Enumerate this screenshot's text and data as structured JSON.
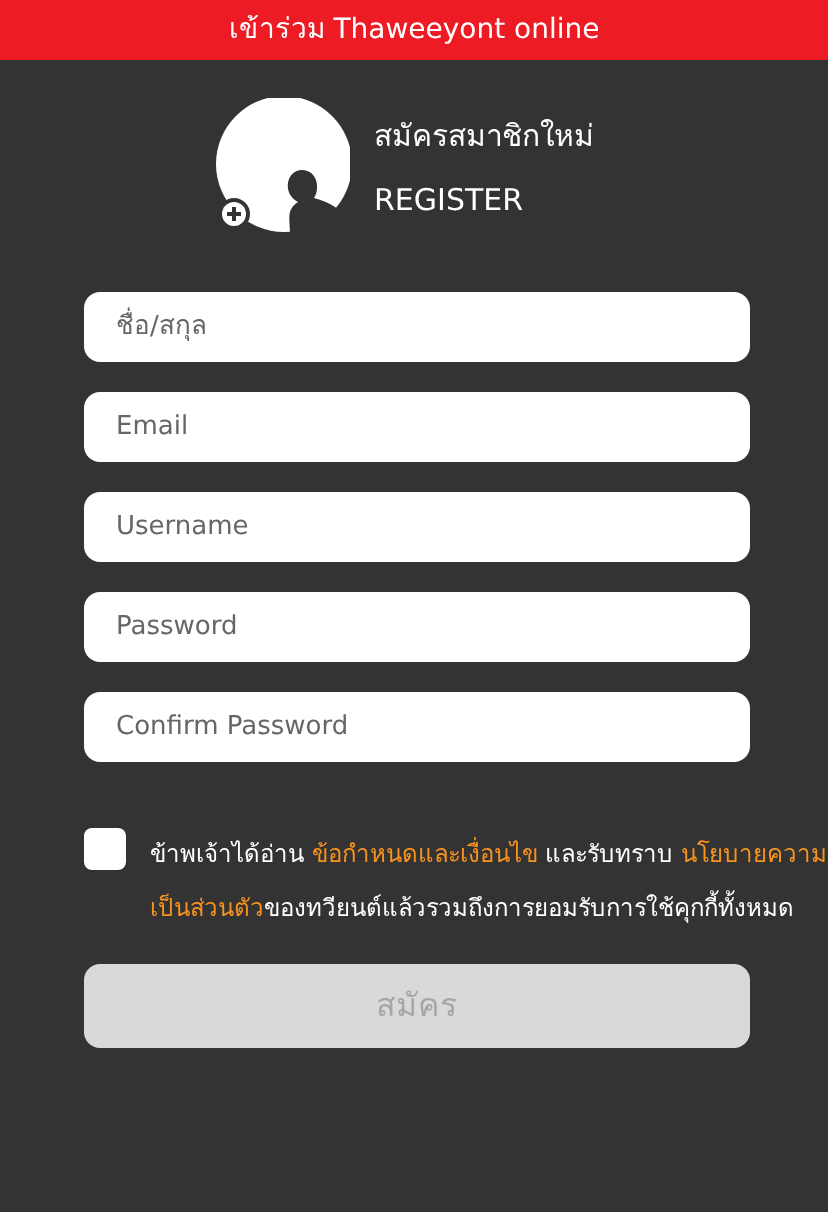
{
  "header": {
    "title": "เข้าร่วม Thaweeyont online"
  },
  "register_heading": {
    "title": "สมัครสมาชิกใหม่",
    "subtitle": "REGISTER"
  },
  "fields": [
    {
      "placeholder": "ชื่อ/สกุล"
    },
    {
      "placeholder": "Email"
    },
    {
      "placeholder": "Username"
    },
    {
      "placeholder": "Password"
    },
    {
      "placeholder": "Confirm Password"
    }
  ],
  "agreement": {
    "checked": false,
    "lines": [
      [
        {
          "kind": "plain",
          "text": "ข้าพเจ้าได้อ่าน "
        },
        {
          "kind": "link",
          "text": "ข้อกำหนดและเงื่อนไข"
        },
        {
          "kind": "plain",
          "text": " และรับทราบ "
        },
        {
          "kind": "link",
          "text": "นโยบายความ"
        }
      ],
      [
        {
          "kind": "link",
          "text": "เป็นส่วนตัว"
        },
        {
          "kind": "plain",
          "text": "ของทวียนต์แล้วรวมถึงการยอมรับการใช้คุกกี้ทั้งหมด"
        }
      ]
    ]
  },
  "submit_button": {
    "label": "สมัคร",
    "disabled": true
  }
}
